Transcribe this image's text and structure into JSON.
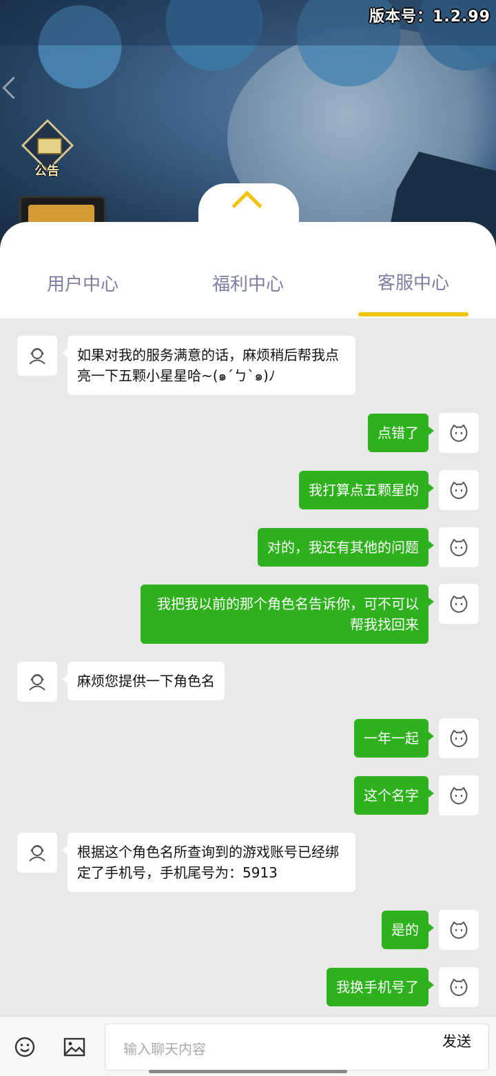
{
  "header": {
    "version_label": "版本号：1.2.99",
    "notice_label": "公告"
  },
  "tabs": [
    {
      "label": "用户中心",
      "active": false
    },
    {
      "label": "福利中心",
      "active": false
    },
    {
      "label": "客服中心",
      "active": true
    }
  ],
  "colors": {
    "accent_yellow": "#f5c400",
    "bubble_green": "#2eb11d",
    "tab_text": "#7d7fa0"
  },
  "messages": [
    {
      "side": "left",
      "text": "如果对我的服务满意的话，麻烦稍后帮我点亮一下五颗小星星哈~(๑ˊㄅˋ๑)ﾉ"
    },
    {
      "side": "right",
      "text": "点错了"
    },
    {
      "side": "right",
      "text": "我打算点五颗星的"
    },
    {
      "side": "right",
      "text": "对的，我还有其他的问题"
    },
    {
      "side": "right",
      "text": "我把我以前的那个角色名告诉你，可不可以帮我找回来"
    },
    {
      "side": "left",
      "text": "麻烦您提供一下角色名"
    },
    {
      "side": "right",
      "text": "一年一起"
    },
    {
      "side": "right",
      "text": "这个名字"
    },
    {
      "side": "left",
      "text": "根据这个角色名所查询到的游戏账号已经绑定了手机号，手机尾号为：5913"
    },
    {
      "side": "right",
      "text": "是的"
    },
    {
      "side": "right",
      "text": "我换手机号了"
    }
  ],
  "input": {
    "placeholder": "输入聊天内容",
    "send_label": "发送"
  },
  "icons": {
    "agent_avatar": "agent-icon",
    "user_avatar": "cat-face-icon",
    "emoji": "smiley-icon",
    "image": "image-icon"
  }
}
